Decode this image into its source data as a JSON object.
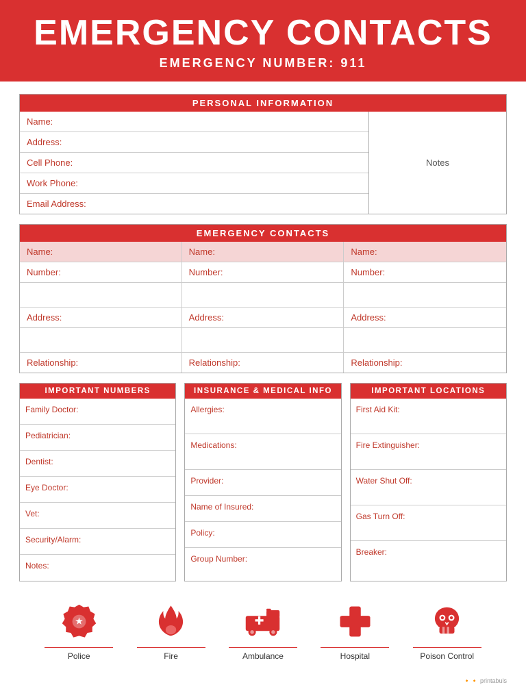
{
  "header": {
    "title": "EMERGENCY CONTACTS",
    "sub_label": "EMERGENCY NUMBER:",
    "sub_number": "911"
  },
  "personal_info": {
    "section_title": "PERSONAL INFORMATION",
    "fields": [
      "Name:",
      "Address:",
      "Cell Phone:",
      "Work Phone:",
      "Email Address:"
    ],
    "notes_label": "Notes"
  },
  "emergency_contacts": {
    "section_title": "EMERGENCY CONTACTS",
    "columns": [
      {
        "fields": [
          "Name:",
          "Number:",
          "",
          "Address:",
          "",
          "Relationship:"
        ]
      },
      {
        "fields": [
          "Name:",
          "Number:",
          "",
          "Address:",
          "",
          "Relationship:"
        ]
      },
      {
        "fields": [
          "Name:",
          "Number:",
          "",
          "Address:",
          "",
          "Relationship:"
        ]
      }
    ]
  },
  "important_numbers": {
    "title": "IMPORTANT NUMBERS",
    "fields": [
      "Family Doctor:",
      "Pediatrician:",
      "Dentist:",
      "Eye Doctor:",
      "Vet:",
      "Security/Alarm:",
      "Notes:"
    ]
  },
  "insurance_medical": {
    "title": "INSURANCE & MEDICAL INFO",
    "fields": [
      "Allergies:",
      "Medications:",
      "Provider:",
      "Name of Insured:",
      "Policy:",
      "Group Number:"
    ]
  },
  "important_locations": {
    "title": "IMPORTANT LOCATIONS",
    "fields": [
      "First Aid Kit:",
      "Fire Extinguisher:",
      "Water Shut Off:",
      "Gas Turn Off:",
      "Breaker:"
    ]
  },
  "icons": [
    {
      "label": "Police",
      "icon": "police"
    },
    {
      "label": "Fire",
      "icon": "fire"
    },
    {
      "label": "Ambulance",
      "icon": "ambulance"
    },
    {
      "label": "Hospital",
      "icon": "hospital"
    },
    {
      "label": "Poison Control",
      "icon": "poison"
    }
  ],
  "footer": {
    "brand": "printabuls"
  }
}
